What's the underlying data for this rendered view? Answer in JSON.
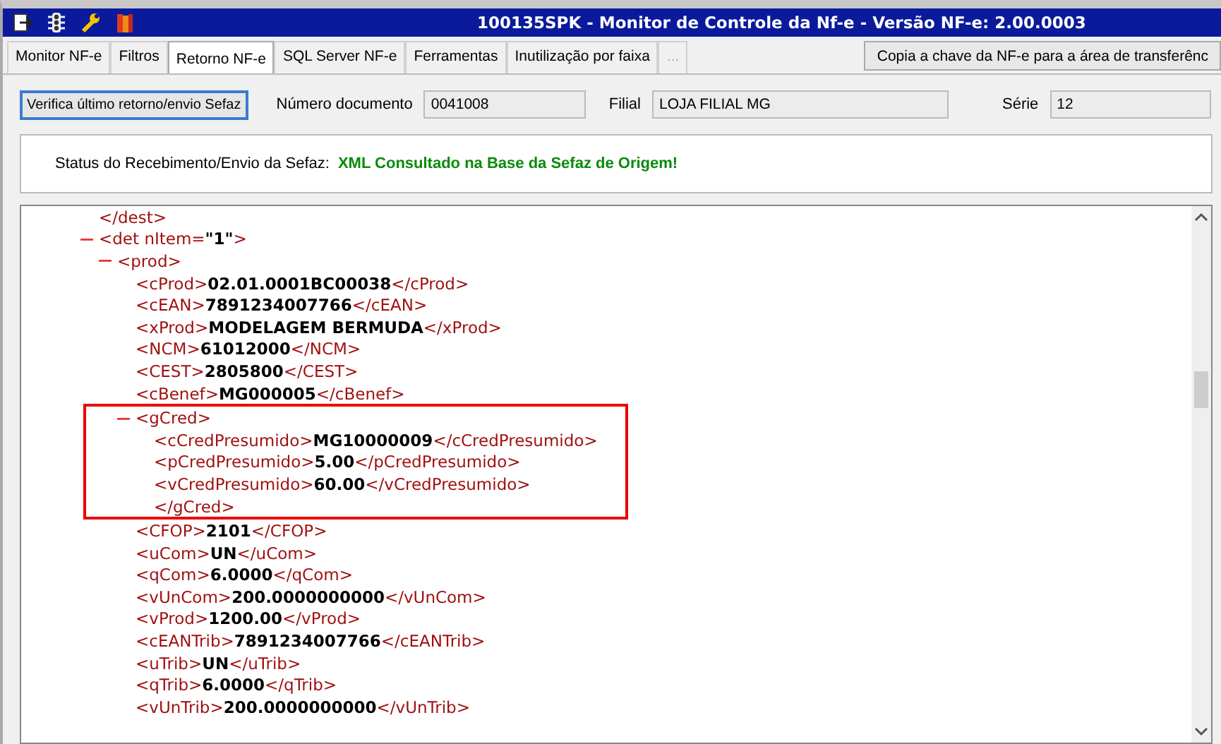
{
  "window": {
    "title": "100135SPK - Monitor de Controle da Nf-e - Versão NF-e: 2.00.0003"
  },
  "tabs": [
    {
      "label": "Monitor NF-e",
      "selected": false,
      "disabled": false
    },
    {
      "label": "Filtros",
      "selected": false,
      "disabled": false
    },
    {
      "label": "Retorno NF-e",
      "selected": true,
      "disabled": false
    },
    {
      "label": "SQL Server NF-e",
      "selected": false,
      "disabled": false
    },
    {
      "label": "Ferramentas",
      "selected": false,
      "disabled": false
    },
    {
      "label": "Inutilização por faixa",
      "selected": false,
      "disabled": false
    },
    {
      "label": "...",
      "selected": false,
      "disabled": true
    }
  ],
  "copy_button": "Copia a chave da NF-e para a área de transferênc",
  "toolbar": {
    "check_button": "Verifica último retorno/envio Sefaz",
    "fields": [
      {
        "label": "Número documento",
        "value": "0041008"
      },
      {
        "label": "Filial",
        "value": "LOJA FILIAL MG"
      },
      {
        "label": "Série",
        "value": "12"
      }
    ]
  },
  "status": {
    "label": "Status do Recebimento/Envio da Sefaz:",
    "value": "XML Consultado na Base da Sefaz de Origem!"
  },
  "xml_tree": [
    {
      "kind": "close",
      "text": "</dest>"
    },
    {
      "kind": "node",
      "open": "<det",
      "attr_name": "nItem=",
      "attr_value": "\"1\"",
      "end": ">",
      "expanded": true,
      "highlighted": false,
      "children": [
        {
          "kind": "node",
          "open": "<prod",
          "end": ">",
          "expanded": true,
          "highlighted": false,
          "children": [
            {
              "kind": "leaf",
              "open": "<cProd>",
              "value": "02.01.0001BC00038",
              "close": "</cProd>"
            },
            {
              "kind": "leaf",
              "open": "<cEAN>",
              "value": "7891234007766",
              "close": "</cEAN>"
            },
            {
              "kind": "leaf",
              "open": "<xProd>",
              "value": "MODELAGEM BERMUDA",
              "close": "</xProd>"
            },
            {
              "kind": "leaf",
              "open": "<NCM>",
              "value": "61012000",
              "close": "</NCM>"
            },
            {
              "kind": "leaf",
              "open": "<CEST>",
              "value": "2805800",
              "close": "</CEST>"
            },
            {
              "kind": "leaf",
              "open": "<cBenef>",
              "value": "MG000005",
              "close": "</cBenef>"
            },
            {
              "kind": "node",
              "open": "<gCred",
              "end": ">",
              "expanded": true,
              "highlighted": true,
              "close": "</gCred>",
              "children": [
                {
                  "kind": "leaf",
                  "open": "<cCredPresumido>",
                  "value": "MG10000009",
                  "close": "</cCredPresumido>"
                },
                {
                  "kind": "leaf",
                  "open": "<pCredPresumido>",
                  "value": "5.00",
                  "close": "</pCredPresumido>"
                },
                {
                  "kind": "leaf",
                  "open": "<vCredPresumido>",
                  "value": "60.00",
                  "close": "</vCredPresumido>"
                }
              ]
            },
            {
              "kind": "leaf",
              "open": "<CFOP>",
              "value": "2101",
              "close": "</CFOP>"
            },
            {
              "kind": "leaf",
              "open": "<uCom>",
              "value": "UN",
              "close": "</uCom>"
            },
            {
              "kind": "leaf",
              "open": "<qCom>",
              "value": "6.0000",
              "close": "</qCom>"
            },
            {
              "kind": "leaf",
              "open": "<vUnCom>",
              "value": "200.0000000000",
              "close": "</vUnCom>"
            },
            {
              "kind": "leaf",
              "open": "<vProd>",
              "value": "1200.00",
              "close": "</vProd>"
            },
            {
              "kind": "leaf",
              "open": "<cEANTrib>",
              "value": "7891234007766",
              "close": "</cEANTrib>"
            },
            {
              "kind": "leaf",
              "open": "<uTrib>",
              "value": "UN",
              "close": "</uTrib>"
            },
            {
              "kind": "leaf",
              "open": "<qTrib>",
              "value": "6.0000",
              "close": "</qTrib>"
            },
            {
              "kind": "leaf",
              "open": "<vUnTrib>",
              "value": "200.0000000000",
              "close": "</vUnTrib>"
            }
          ]
        }
      ]
    }
  ]
}
